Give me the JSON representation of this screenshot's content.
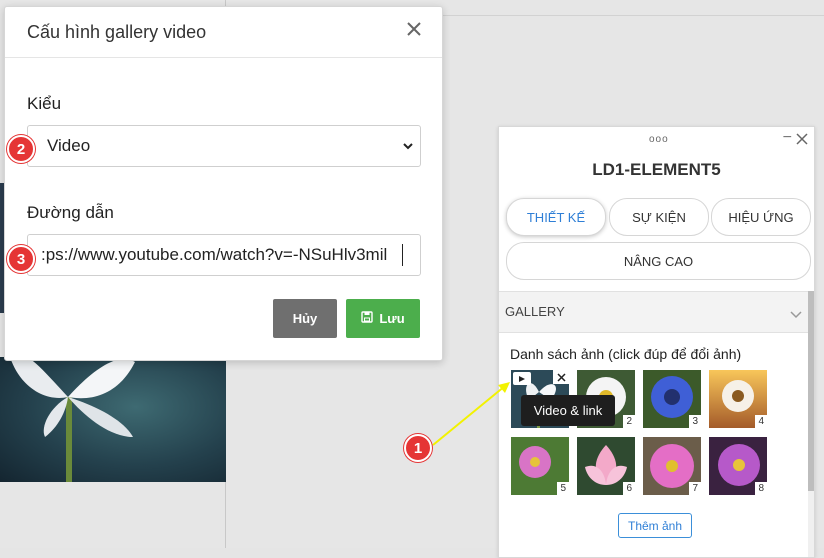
{
  "modal": {
    "title": "Cấu hình gallery video",
    "type_label": "Kiểu",
    "type_value": "Video",
    "path_label": "Đường dẫn",
    "path_value": ":ps://www.youtube.com/watch?v=-NSuHlv3mil",
    "cancel_label": "Hủy",
    "save_label": "Lưu"
  },
  "markers": {
    "m1": "1",
    "m2": "2",
    "m3": "3"
  },
  "panel": {
    "dots": "ooo",
    "minimize": "−",
    "title": "LD1-ELEMENT5",
    "tabs": [
      {
        "label": "THIẾT KẾ",
        "active": true
      },
      {
        "label": "SỰ KIỆN",
        "active": false
      },
      {
        "label": "HIỆU ỨNG",
        "active": false
      },
      {
        "label": "NÂNG CAO",
        "active": false
      }
    ],
    "section": "GALLERY",
    "list_caption": "Danh sách ảnh (click đúp để đổi ảnh)",
    "tooltip": "Video & link",
    "add_button": "Thêm ảnh",
    "thumbnails": [
      {
        "num": "1",
        "kind": "white-flower-video"
      },
      {
        "num": "2",
        "kind": "white-daisy"
      },
      {
        "num": "3",
        "kind": "blue-cornflower"
      },
      {
        "num": "4",
        "kind": "sunset-daisy"
      },
      {
        "num": "5",
        "kind": "pink-cosmos-grass"
      },
      {
        "num": "6",
        "kind": "pink-lotus"
      },
      {
        "num": "7",
        "kind": "pink-cosmos"
      },
      {
        "num": "8",
        "kind": "purple-cosmos"
      }
    ]
  },
  "colors": {
    "accent_blue": "#2f7fd6",
    "save_green": "#4cae4c",
    "cancel_grey": "#6f6f6f",
    "marker_red": "#e53535",
    "annotation_yellow": "#f2f200"
  },
  "icons": [
    "close-icon",
    "chevron-down-icon",
    "save-icon",
    "youtube-icon",
    "minimize-icon"
  ]
}
